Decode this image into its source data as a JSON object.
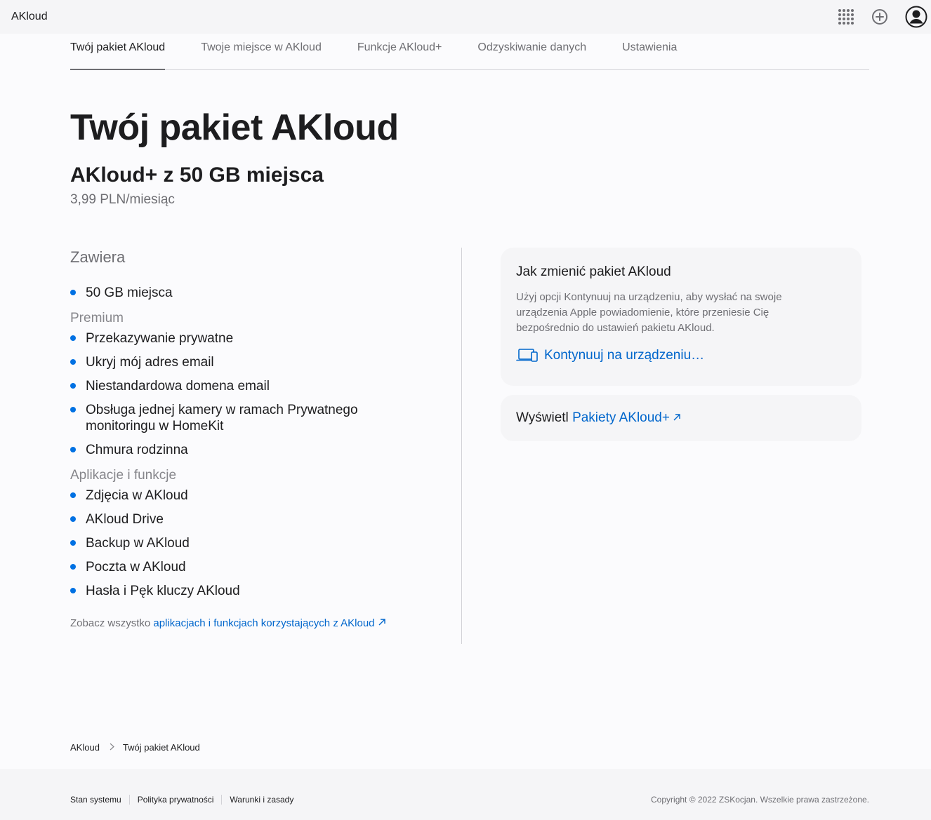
{
  "app": {
    "brand": "AKloud"
  },
  "topbar": {
    "apps_icon": "apps-grid-icon",
    "add_icon": "plus-circle-icon",
    "account_icon": "account-icon"
  },
  "tabs": [
    {
      "label": "Twój pakiet AKloud",
      "active": true
    },
    {
      "label": "Twoje miejsce w AKloud"
    },
    {
      "label": "Funkcje AKloud+"
    },
    {
      "label": "Odzyskiwanie danych"
    },
    {
      "label": "Ustawienia"
    }
  ],
  "header": {
    "title": "Twój pakiet AKloud",
    "plan": "AKloud+ z 50 GB miejsca",
    "price": "3,99 PLN/miesiąc"
  },
  "includes": {
    "title": "Zawiera",
    "storage": [
      "50 GB miejsca"
    ],
    "premium_title": "Premium",
    "premium": [
      "Przekazywanie prywatne",
      "Ukryj mój adres email",
      "Niestandardowa domena email",
      "Obsługa jednej kamery w ramach Prywatnego monitoringu w HomeKit",
      "Chmura rodzinna"
    ],
    "apps_title": "Aplikacje i funkcje",
    "apps": [
      "Zdjęcia w AKloud",
      "AKloud Drive",
      "Backup w AKloud",
      "Poczta w AKloud",
      "Hasła i Pęk kluczy AKloud"
    ],
    "see_all_prefix": "Zobacz wszystko ",
    "see_all_link": "aplikacjach i funkcjach korzystających z AKloud"
  },
  "change_card": {
    "title": "Jak zmienić pakiet AKloud",
    "body": "Użyj opcji Kontynuuj na urządzeniu, aby wysłać na swoje urządzenia Apple powiadomienie, które przeniesie Cię bezpośrednio do ustawień pakietu AKloud.",
    "action": "Kontynuuj na urządzeniu…",
    "action_icon": "laptop-icon"
  },
  "plans_card": {
    "prefix": "Wyświetl ",
    "link": "Pakiety AKloud+"
  },
  "breadcrumb": {
    "items": [
      "AKloud",
      "Twój pakiet AKloud"
    ]
  },
  "footer": {
    "links": [
      "Stan systemu",
      "Polityka prywatności",
      "Warunki i zasady"
    ],
    "copyright": "Copyright © 2022 ZSKocjan. Wszelkie prawa zastrzeżone."
  },
  "colors": {
    "accent": "#0071e3",
    "link": "#0066cc",
    "background": "#fbfbfd"
  }
}
